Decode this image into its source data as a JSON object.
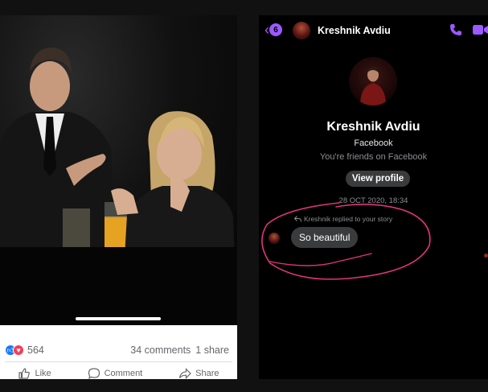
{
  "post": {
    "reaction_count": "564",
    "comments": "34 comments",
    "shares": "1 share",
    "actions": {
      "like": "Like",
      "comment": "Comment",
      "share": "Share"
    }
  },
  "messenger": {
    "back_badge_count": "6",
    "contact_name": "Kreshnik Avdiu",
    "profile": {
      "name": "Kreshnik Avdiu",
      "source": "Facebook",
      "friend_status": "You're friends on Facebook",
      "view_profile_label": "View profile"
    },
    "thread": {
      "timestamp": "28 OCT 2020, 18:34",
      "reply_note": "Kreshnik replied to your story",
      "message": "So beautiful"
    }
  },
  "colors": {
    "messenger_accent": "#9b59ff",
    "facebook_blue": "#1877f2",
    "love_red": "#f33e58",
    "annotation_pink": "#e0347a",
    "bubble_gray": "#3a3b3c"
  }
}
